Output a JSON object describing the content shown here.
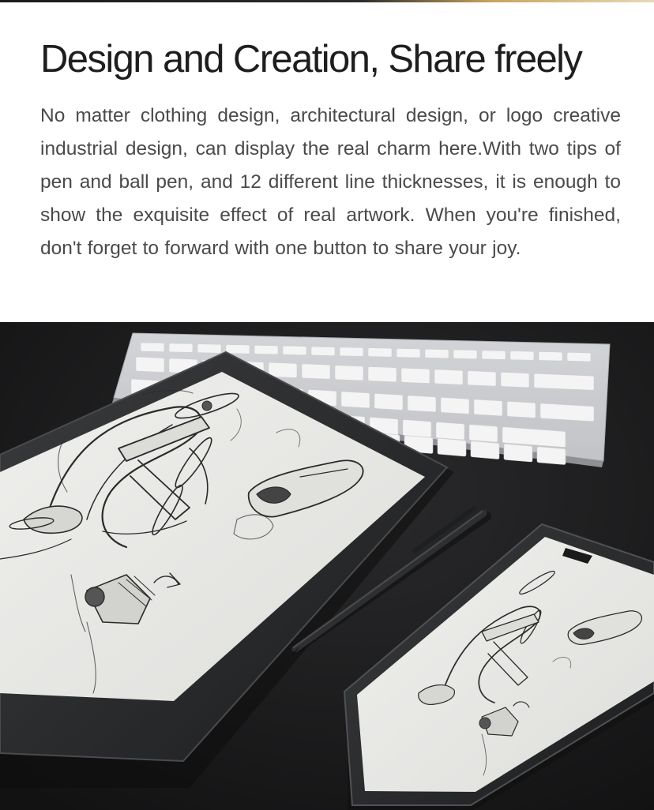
{
  "headline": "Design and Creation, Share freely",
  "description": "No matter clothing design, architectural design, or logo creative industrial design, can display the real charm here.With two tips of pen and ball pen, and 12 different line thicknesses, it is enough to show the exquisite effect of real artwork. When you're finished, don't forget to forward with one button to share your joy.",
  "photo": {
    "devices": [
      "e-ink-tablet",
      "wireless-keyboard",
      "stylus-pen",
      "smartphone"
    ],
    "artwork": "drone-sketch"
  },
  "colors": {
    "heading": "#1e1e1e",
    "body_text": "#4a4a4a",
    "desk": "#1b1b1c",
    "device_frame": "#242526",
    "eink_screen": "#e9e9e7",
    "keyboard": "#e6e6e8"
  }
}
